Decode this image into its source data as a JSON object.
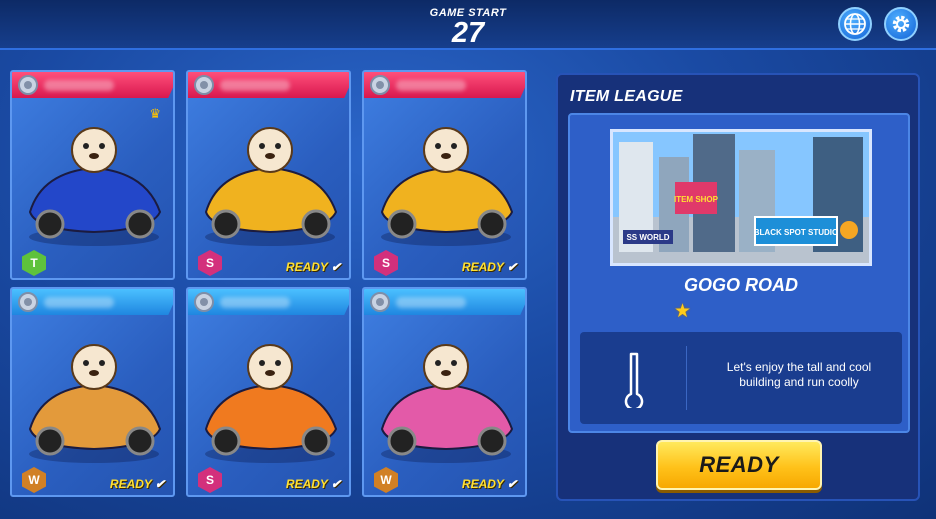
{
  "header": {
    "label": "GAME START",
    "countdown": "27"
  },
  "icons": {
    "language": "globe-icon",
    "settings": "gear-icon"
  },
  "players": [
    {
      "team": "red",
      "license": "T",
      "ready": false,
      "crown": true
    },
    {
      "team": "red",
      "license": "S",
      "ready": true
    },
    {
      "team": "red",
      "license": "S",
      "ready": true
    },
    {
      "team": "blue",
      "license": "W",
      "ready": true
    },
    {
      "team": "blue",
      "license": "S",
      "ready": true
    },
    {
      "team": "blue",
      "license": "W",
      "ready": true
    }
  ],
  "ready_text": "READY",
  "mode": {
    "title": "ITEM LEAGUE"
  },
  "track": {
    "name": "GOGO ROAD",
    "difficulty_stars": 1,
    "description": "Let's enjoy the tall and cool building and run coolly",
    "sign_text_1": "ITEM SHOP",
    "sign_text_2": "BLACK SPOT STUDIO",
    "sign_text_3": "SS WORLD"
  },
  "ready_button": "READY",
  "colors": {
    "red_team": "#e62a5c",
    "blue_team": "#2a9ff0",
    "button": "#ffd22e"
  }
}
